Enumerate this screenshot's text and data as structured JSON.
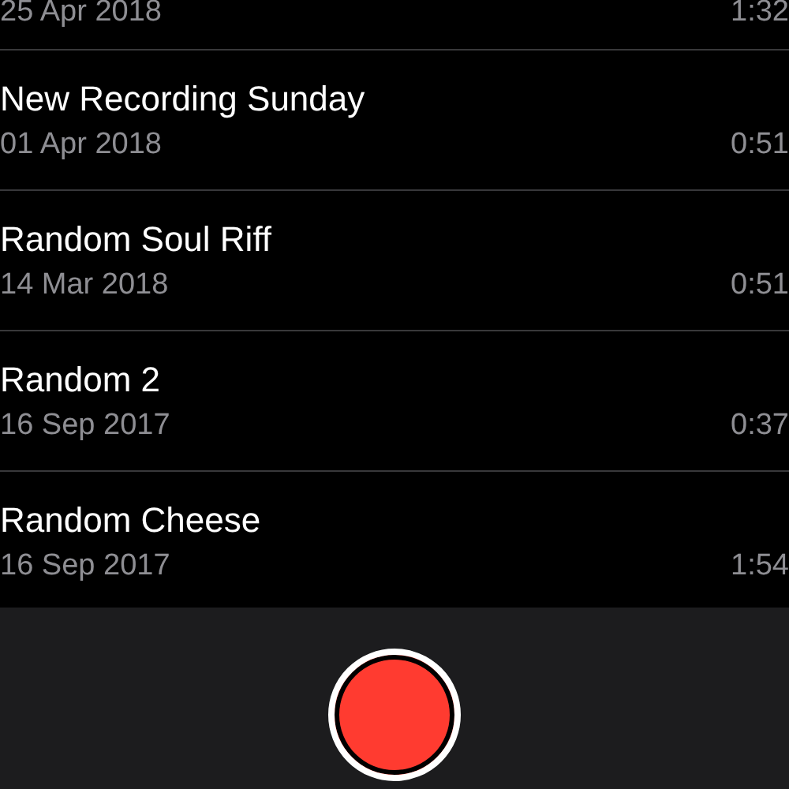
{
  "recordings": [
    {
      "date": "25 Apr 2018",
      "duration": "1:32"
    },
    {
      "title": "New Recording Sunday",
      "date": "01 Apr 2018",
      "duration": "0:51"
    },
    {
      "title": "Random Soul Riff",
      "date": "14 Mar 2018",
      "duration": "0:51"
    },
    {
      "title": "Random 2",
      "date": "16 Sep 2017",
      "duration": "0:37"
    },
    {
      "title": "Random Cheese",
      "date": "16 Sep 2017",
      "duration": "1:54"
    }
  ]
}
